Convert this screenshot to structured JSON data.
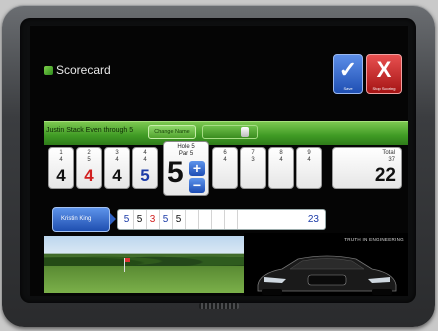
{
  "app": {
    "title": "Scorecard"
  },
  "toolbar": {
    "save_label": "Save",
    "stop_label": "Stop Scoring",
    "save_glyph": "✓",
    "stop_glyph": "X"
  },
  "player": {
    "status": "Justin Stack  Even through 5",
    "change_label": "Change Name"
  },
  "holes": [
    {
      "hole": "1",
      "par": "4",
      "score": "4",
      "color": "#111111"
    },
    {
      "hole": "2",
      "par": "5",
      "score": "4",
      "color": "#d11f1f"
    },
    {
      "hole": "3",
      "par": "4",
      "score": "4",
      "color": "#111111"
    },
    {
      "hole": "4",
      "par": "4",
      "score": "5",
      "color": "#1d3ca8"
    },
    {
      "hole": "6",
      "par": "4",
      "score": ""
    },
    {
      "hole": "7",
      "par": "3",
      "score": ""
    },
    {
      "hole": "8",
      "par": "4",
      "score": ""
    },
    {
      "hole": "9",
      "par": "4",
      "score": ""
    }
  ],
  "current": {
    "hole_label": "Hole 5",
    "par_label": "Par 5",
    "score": "5",
    "plus": "+",
    "minus": "−"
  },
  "total": {
    "label": "Total",
    "par": "37",
    "score": "22"
  },
  "opponent": {
    "name": "Kristin King",
    "scores": [
      {
        "v": "5",
        "color": "#1d3ca8"
      },
      {
        "v": "5",
        "color": "#111111"
      },
      {
        "v": "3",
        "color": "#d11f1f"
      },
      {
        "v": "5",
        "color": "#1d3ca8"
      },
      {
        "v": "5",
        "color": "#111111"
      }
    ],
    "total": "23"
  },
  "ad": {
    "tagline": "TRUTH IN ENGINEERING"
  }
}
